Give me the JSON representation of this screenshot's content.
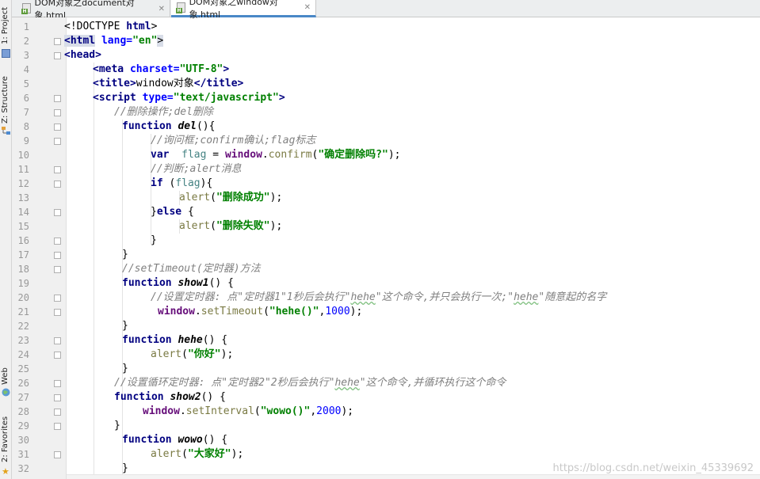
{
  "side_tabs": [
    {
      "label": "1: Project",
      "icon": "project-folder-icon"
    },
    {
      "label": "Z: Structure",
      "icon": "structure-icon"
    },
    {
      "label": "Web",
      "icon": "web-globe-icon"
    },
    {
      "label": "2: Favorites",
      "icon": "favorites-star-icon"
    }
  ],
  "tabs": [
    {
      "label": "DOM对象之document对象.html",
      "close": "✕",
      "active": false
    },
    {
      "label": "DOM对象之window对象.html",
      "close": "✕",
      "active": true
    }
  ],
  "line_numbers": [
    "1",
    "2",
    "3",
    "4",
    "5",
    "6",
    "7",
    "8",
    "9",
    "10",
    "11",
    "12",
    "13",
    "14",
    "15",
    "16",
    "17",
    "18",
    "19",
    "20",
    "21",
    "22",
    "23",
    "24",
    "25",
    "26",
    "27",
    "28",
    "29",
    "30",
    "31",
    "32"
  ],
  "code": {
    "l1": {
      "a": "<!DOCTYPE ",
      "b": "html",
      "c": ">"
    },
    "l2": {
      "a": "<html",
      "b": " lang=",
      "c": "\"en\"",
      "d": ">"
    },
    "l3": {
      "a": "<head>"
    },
    "l4": {
      "a": "<meta",
      "b": " charset=",
      "c": "\"UTF-8\"",
      "d": ">"
    },
    "l5": {
      "a": "<title>",
      "b": "window对象",
      "c": "</title>"
    },
    "l6": {
      "a": "<script",
      "b": " type=",
      "c": "\"text/javascript\"",
      "d": ">"
    },
    "l7": {
      "a": "//删除操作;del删除"
    },
    "l8": {
      "a": "function ",
      "b": "del",
      "c": "(){"
    },
    "l9": {
      "a": "//询问框;confirm确认;flag标志"
    },
    "l10": {
      "a": "var  ",
      "b": "flag",
      "c": " = ",
      "d": "window",
      "e": ".",
      "f": "confirm",
      "g": "(",
      "h": "\"确定删除吗?\"",
      "i": ");"
    },
    "l11": {
      "a": "//判断;alert消息"
    },
    "l12": {
      "a": "if ",
      "b": "(",
      "c": "flag",
      "d": "){"
    },
    "l13": {
      "a": "alert",
      "b": "(",
      "c": "\"删除成功\"",
      "d": ");"
    },
    "l14": {
      "a": "}",
      "b": "else",
      "c": " {"
    },
    "l15": {
      "a": "alert",
      "b": "(",
      "c": "\"删除失败\"",
      "d": ");"
    },
    "l16": {
      "a": "}"
    },
    "l17": {
      "a": "}"
    },
    "l18": {
      "a": "//setTimeout(定时器)方法"
    },
    "l19": {
      "a": "function ",
      "b": "show1",
      "c": "() {"
    },
    "l20": {
      "a": "//设置定时器: 点\"定时器1\"1秒后会执行\"",
      "b": "hehe",
      "c": "\"这个命令,并只会执行一次;\"",
      "d": "hehe",
      "e": "\"随意起的名字"
    },
    "l21": {
      "a": "window",
      "b": ".",
      "c": "setTimeout",
      "d": "(",
      "e": "\"hehe()\"",
      "f": ",",
      "g": "1000",
      "h": ");"
    },
    "l22": {
      "a": "}"
    },
    "l23": {
      "a": "function ",
      "b": "hehe",
      "c": "() {"
    },
    "l24": {
      "a": "alert",
      "b": "(",
      "c": "\"你好\"",
      "d": ");"
    },
    "l25": {
      "a": "}"
    },
    "l26": {
      "a": "//设置循环定时器: 点\"定时器2\"2秒后会执行\"",
      "b": "hehe",
      "c": "\"这个命令,并循环执行这个命令"
    },
    "l27": {
      "a": "function ",
      "b": "show2",
      "c": "() {"
    },
    "l28": {
      "a": "window",
      "b": ".",
      "c": "setInterval",
      "d": "(",
      "e": "\"wowo()\"",
      "f": ",",
      "g": "2000",
      "h": ");"
    },
    "l29": {
      "a": "}"
    },
    "l30": {
      "a": "function ",
      "b": "wowo",
      "c": "() {"
    },
    "l31": {
      "a": "alert",
      "b": "(",
      "c": "\"大家好\"",
      "d": ");"
    },
    "l32": {
      "a": "}"
    }
  },
  "watermark": "https://blog.csdn.net/weixin_45339692",
  "colors": {
    "tag": "#000080",
    "attribute": "#0000ff",
    "string": "#008000",
    "comment": "#808080",
    "global": "#660e7a",
    "active_tab_underline": "#4a88c7"
  }
}
